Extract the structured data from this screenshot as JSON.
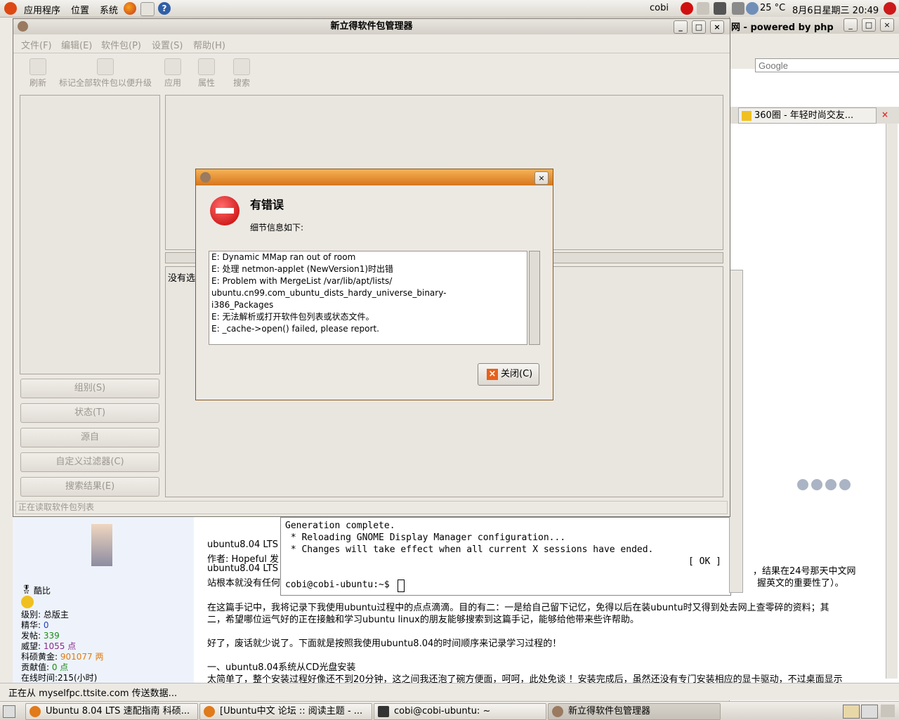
{
  "top_panel": {
    "menus": [
      "应用程序",
      "位置",
      "系统"
    ],
    "user": "cobi",
    "weather": "25 °C",
    "datetime": "8月6日星期三  20:49"
  },
  "synaptic": {
    "title": "新立得软件包管理器",
    "menus": [
      "文件(F)",
      "编辑(E)",
      "软件包(P)",
      "设置(S)",
      "帮助(H)"
    ],
    "toolbar": [
      "刷新",
      "标记全部软件包以便升级",
      "应用",
      "属性",
      "搜索"
    ],
    "filters": [
      "组别(S)",
      "状态(T)",
      "源自",
      "自定义过滤器(C)",
      "搜索结果(E)"
    ],
    "no_selection": "没有选",
    "status": "正在读取软件包列表"
  },
  "dialog": {
    "heading": "有错误",
    "subheading": "细节信息如下:",
    "errors": [
      "E: Dynamic MMap ran out of room",
      "E: 处理 netmon-applet (NewVersion1)时出错",
      "E: Problem with MergeList /var/lib/apt/lists/",
      "ubuntu.cn99.com_ubuntu_dists_hardy_universe_binary-",
      "i386_Packages",
      "E: 无法解析或打开软件包列表或状态文件。",
      "E: _cache->open() failed, please report."
    ],
    "close_label": "关闭(C)"
  },
  "firefox": {
    "title": "网 - powered by php",
    "search_placeholder": "Google",
    "tab": "360圈 - 年轻时尚交友...",
    "status": "正在从 myselfpc.ttsite.com 传送数据..."
  },
  "terminal": {
    "lines": [
      "Generation complete.",
      " * Reloading GNOME Display Manager configuration...",
      " * Changes will take effect when all current X sessions have ended."
    ],
    "ok": "[ OK ]",
    "prompt": "cobi@cobi-ubuntu:~$ "
  },
  "page": {
    "lines": [
      "ubuntu8.04 LTS",
      "作者: Hopeful 发",
      "ubuntu8.04 LTS",
      "站根本就没有任何",
      "，结果在24号那天中文网",
      "握英文的重要性了）。",
      "在这篇手记中，我将记录下我使用ubuntu过程中的点点滴滴。目的有二：一是给自己留下记忆，免得以后在装ubuntu时又得到处去网上查零碎的资料；其",
      "二，希望哪位运气好的正在接触和学习ubuntu linux的朋友能够搜索到这篇手记，能够给他带来些许帮助。",
      "好了，废话就少说了。下面就是按照我使用ubuntu8.04的时间顺序来记录学习过程的！",
      "一、ubuntu8.04系统从CD光盘安装",
      "太简单了，整个安装过程好像还不到20分钟，这之间我还泡了碗方便面，呵呵，此处免谈 ！安装完成后，虽然还没有专门安装相应的显卡驱动，不过桌面显示"
    ],
    "user": {
      "name": "酷比",
      "rank": "级别: 总版主",
      "stats": [
        {
          "label": "精华: ",
          "value": "0",
          "color": "#1f3fbf"
        },
        {
          "label": "发帖: ",
          "value": "339",
          "color": "#1a8a1a"
        },
        {
          "label": "威望: ",
          "value": "1055 点",
          "color": "#8a2a8a"
        },
        {
          "label": "科硕黄金: ",
          "value": "901077 两",
          "color": "#e07a10"
        },
        {
          "label": "贡献值: ",
          "value": "0 点",
          "color": "#1a8a1a"
        },
        {
          "label": "在线时间:",
          "value": "215(小时)",
          "color": "#000000"
        }
      ]
    }
  },
  "taskbar": [
    "Ubuntu 8.04 LTS 速配指南 科硕...",
    "[Ubuntu中文 论坛 :: 阅读主题 - ...",
    "cobi@cobi-ubuntu: ~",
    "新立得软件包管理器"
  ]
}
